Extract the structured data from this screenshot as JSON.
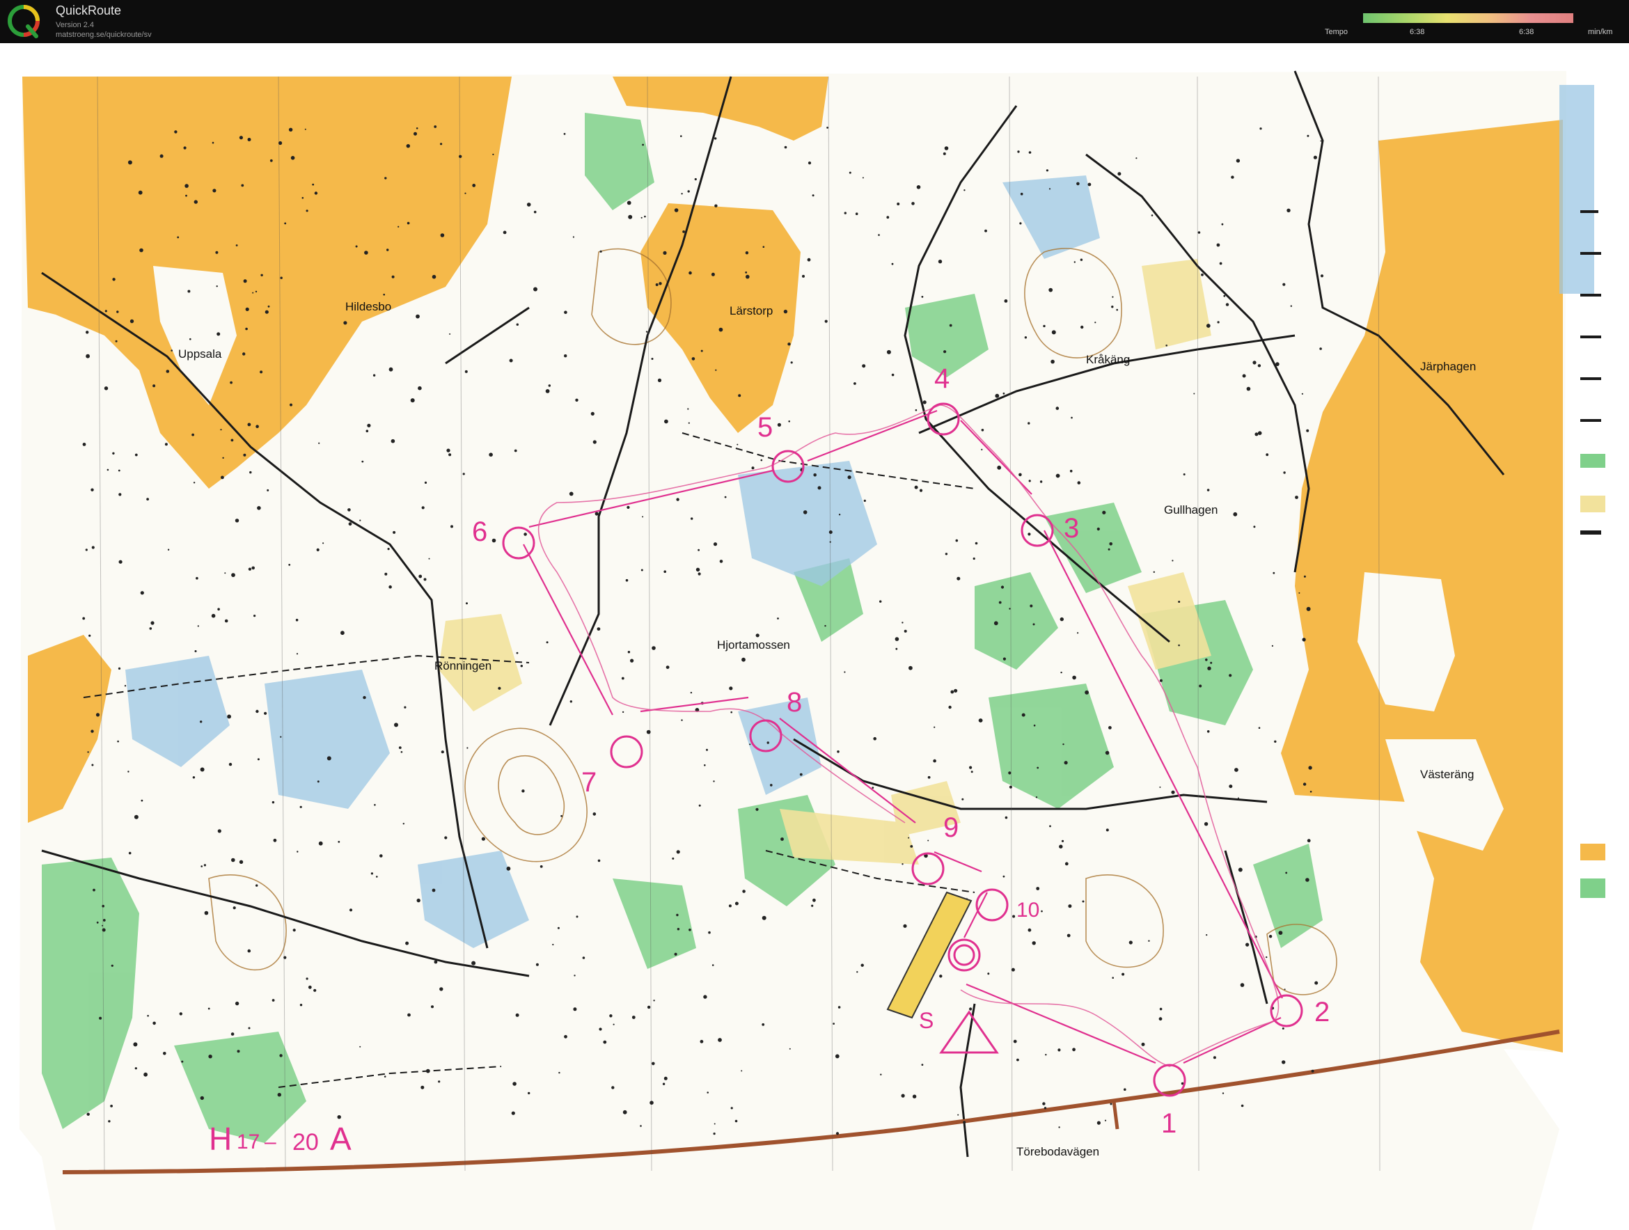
{
  "app": {
    "title": "QuickRoute",
    "version": "Version 2.4",
    "url": "matstroeng.se/quickroute/sv",
    "logo_icon": "quickroute-q-logo"
  },
  "legend": {
    "label": "Tempo",
    "min_value": "6:38",
    "max_value": "6:38",
    "unit": "min/km"
  },
  "colors": {
    "open_land": "#f5b94a",
    "forest_green": "#7fd08a",
    "marsh_blue": "#9cc7e4",
    "course_magenta": "#e0308f",
    "road_brown": "#a0522d",
    "contour_brown": "#a9742f"
  },
  "map": {
    "place_names": [
      "Hildesbo",
      "Uppsala",
      "Lärstorp",
      "Kråkäng",
      "Järphagen",
      "Gullhagen",
      "Rönningen",
      "Hjortamossen",
      "Västeräng",
      "Törebodavägen"
    ],
    "class_label": {
      "part1": "H",
      "part2": "17",
      "dash": "–",
      "part3": "20",
      "part4": "A"
    },
    "controls": [
      "1",
      "2",
      "3",
      "4",
      "5",
      "6",
      "7",
      "8",
      "9",
      "10"
    ],
    "start_label": "S"
  }
}
